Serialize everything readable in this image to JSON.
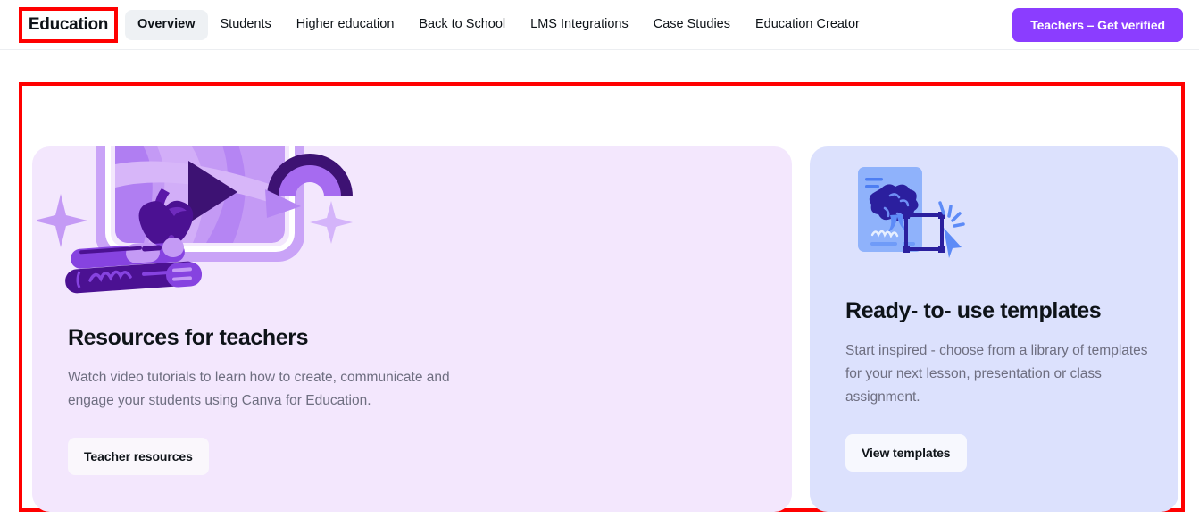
{
  "nav": {
    "brand": "Education",
    "tabs": [
      {
        "label": "Overview",
        "active": true
      },
      {
        "label": "Students",
        "active": false
      },
      {
        "label": "Higher education",
        "active": false
      },
      {
        "label": "Back to School",
        "active": false
      },
      {
        "label": "LMS Integrations",
        "active": false
      },
      {
        "label": "Case Studies",
        "active": false
      },
      {
        "label": "Education Creator",
        "active": false
      }
    ],
    "cta_label": "Teachers – Get verified",
    "cta_color": "#8B3DFF"
  },
  "cards": [
    {
      "title": "Resources for teachers",
      "description": "Watch video tutorials to learn how to create, communicate and engage your students using Canva for Education.",
      "button_label": "Teacher resources",
      "background": "#F3E7FD",
      "illustration": "video-player-apple-books-illustration"
    },
    {
      "title": "Ready- to- use templates",
      "description": "Start inspired - choose from a library of templates for your next lesson, presentation or class assignment.",
      "button_label": "View templates",
      "background": "#DCE1FD",
      "illustration": "template-poster-frame-illustration"
    }
  ],
  "annotations": {
    "highlight_color": "#FF0000",
    "brand_highlight": "Education",
    "region_highlight": "content-cards-region"
  }
}
